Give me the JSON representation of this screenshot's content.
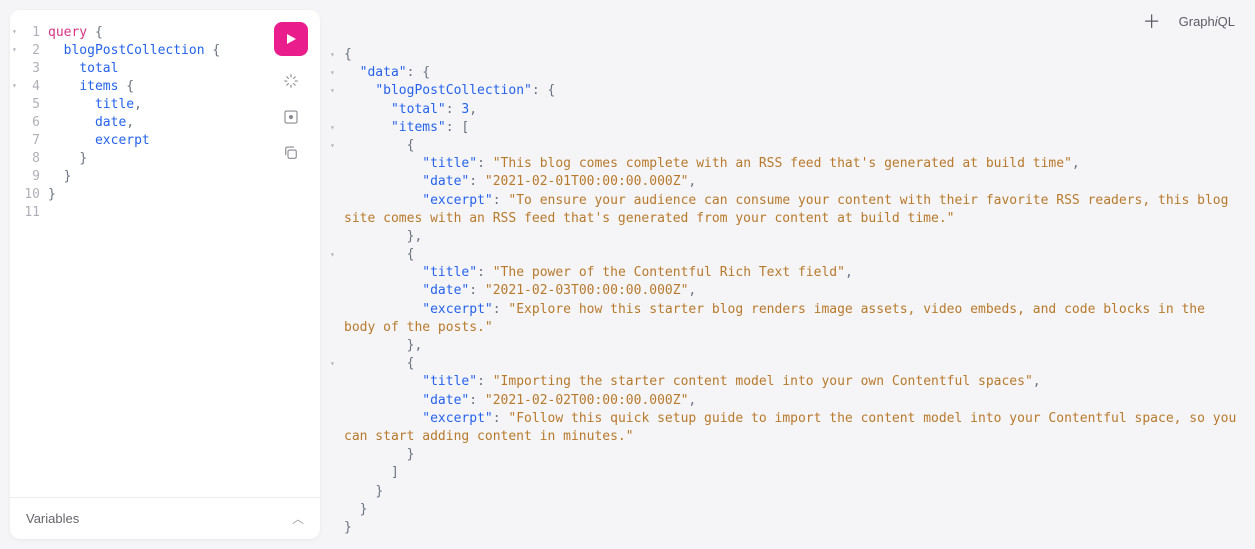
{
  "query": {
    "lines": [
      {
        "n": "1",
        "fold": true,
        "tokens": [
          [
            "keyword",
            "query"
          ],
          [
            "text",
            " "
          ],
          [
            "brace",
            "{"
          ]
        ]
      },
      {
        "n": "2",
        "fold": true,
        "tokens": [
          [
            "text",
            "  "
          ],
          [
            "field",
            "blogPostCollection"
          ],
          [
            "text",
            " "
          ],
          [
            "brace",
            "{"
          ]
        ]
      },
      {
        "n": "3",
        "tokens": [
          [
            "text",
            "    "
          ],
          [
            "field",
            "total"
          ]
        ]
      },
      {
        "n": "4",
        "fold": true,
        "tokens": [
          [
            "text",
            "    "
          ],
          [
            "field",
            "items"
          ],
          [
            "text",
            " "
          ],
          [
            "brace",
            "{"
          ]
        ]
      },
      {
        "n": "5",
        "tokens": [
          [
            "text",
            "      "
          ],
          [
            "field",
            "title"
          ],
          [
            "brace",
            ","
          ]
        ]
      },
      {
        "n": "6",
        "tokens": [
          [
            "text",
            "      "
          ],
          [
            "field",
            "date"
          ],
          [
            "brace",
            ","
          ]
        ]
      },
      {
        "n": "7",
        "tokens": [
          [
            "text",
            "      "
          ],
          [
            "field",
            "excerpt"
          ]
        ]
      },
      {
        "n": "8",
        "tokens": [
          [
            "text",
            "    "
          ],
          [
            "brace",
            "}"
          ]
        ]
      },
      {
        "n": "9",
        "tokens": [
          [
            "text",
            "  "
          ],
          [
            "brace",
            "}"
          ]
        ]
      },
      {
        "n": "10",
        "tokens": [
          [
            "brace",
            "}"
          ]
        ]
      },
      {
        "n": "11",
        "tokens": []
      }
    ]
  },
  "result": {
    "data": {
      "blogPostCollection": {
        "total": 3,
        "items": [
          {
            "title": "This blog comes complete with an RSS feed that's generated at build time",
            "date": "2021-02-01T00:00:00.000Z",
            "excerpt": "To ensure your audience can consume your content with their favorite RSS readers, this blog site comes with an RSS feed that's generated from your content at build time."
          },
          {
            "title": "The power of the Contentful Rich Text field",
            "date": "2021-02-03T00:00:00.000Z",
            "excerpt": "Explore how this starter blog renders image assets, video embeds, and code blocks in the body of the posts."
          },
          {
            "title": "Importing the starter content model into your own Contentful spaces",
            "date": "2021-02-02T00:00:00.000Z",
            "excerpt": "Follow this quick setup guide to import the content model into your Contentful space, so you can start adding content in minutes."
          }
        ]
      }
    }
  },
  "variables_label": "Variables",
  "logo_parts": {
    "pre": "Graph",
    "i": "i",
    "post": "QL"
  }
}
